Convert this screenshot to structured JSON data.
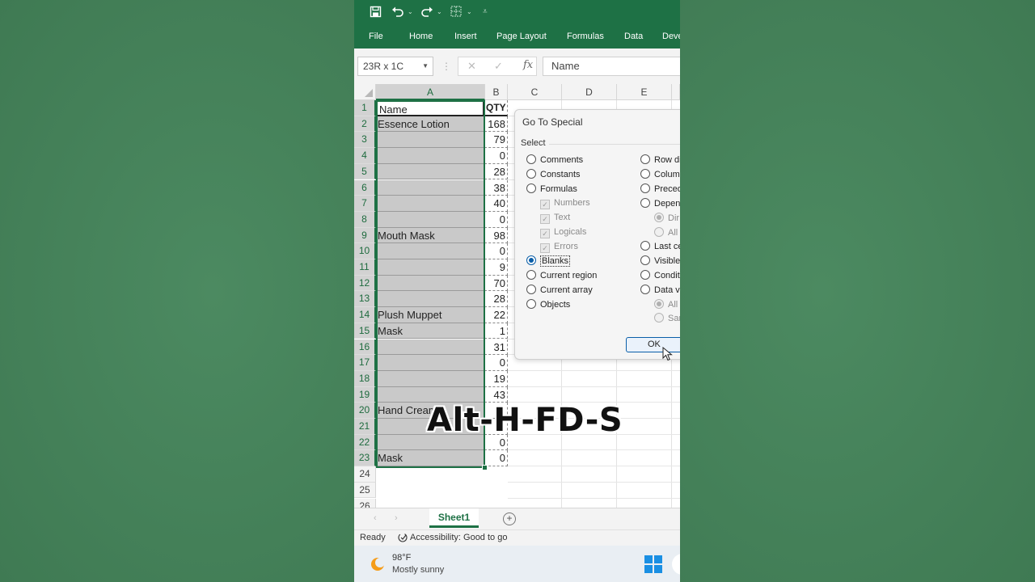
{
  "quick_access": {
    "save_icon": "save-icon",
    "undo_icon": "undo-icon",
    "redo_icon": "redo-icon",
    "borders_icon": "borders-icon",
    "more_icon": "customize-icon"
  },
  "ribbon_tabs": [
    "File",
    "Home",
    "Insert",
    "Page Layout",
    "Formulas",
    "Data",
    "Deve"
  ],
  "name_box": "23R x 1C",
  "formula_bar": {
    "cancel": "✕",
    "enter": "✓",
    "fx": "fx",
    "value": "Name"
  },
  "columns": [
    "A",
    "B",
    "C",
    "D",
    "E"
  ],
  "rows": [
    {
      "num": "1",
      "a": "Name",
      "b": "QTY"
    },
    {
      "num": "2",
      "a": "Essence Lotion",
      "b": "168"
    },
    {
      "num": "3",
      "a": "",
      "b": "79"
    },
    {
      "num": "4",
      "a": "",
      "b": "0"
    },
    {
      "num": "5",
      "a": "",
      "b": "28"
    },
    {
      "num": "6",
      "a": "",
      "b": "38"
    },
    {
      "num": "7",
      "a": "",
      "b": "40"
    },
    {
      "num": "8",
      "a": "",
      "b": "0"
    },
    {
      "num": "9",
      "a": "Mouth Mask",
      "b": "98"
    },
    {
      "num": "10",
      "a": "",
      "b": "0"
    },
    {
      "num": "11",
      "a": "",
      "b": "9"
    },
    {
      "num": "12",
      "a": "",
      "b": "70"
    },
    {
      "num": "13",
      "a": "",
      "b": "28"
    },
    {
      "num": "14",
      "a": "Plush Muppet",
      "b": "22"
    },
    {
      "num": "15",
      "a": "Mask",
      "b": "1"
    },
    {
      "num": "16",
      "a": "",
      "b": "31"
    },
    {
      "num": "17",
      "a": "",
      "b": "0"
    },
    {
      "num": "18",
      "a": "",
      "b": "19"
    },
    {
      "num": "19",
      "a": "",
      "b": "43"
    },
    {
      "num": "20",
      "a": "Hand Cream",
      "b": ""
    },
    {
      "num": "21",
      "a": "",
      "b": ""
    },
    {
      "num": "22",
      "a": "",
      "b": "0"
    },
    {
      "num": "23",
      "a": "Mask",
      "b": "0"
    },
    {
      "num": "24",
      "a": "",
      "b": ""
    },
    {
      "num": "25",
      "a": "",
      "b": ""
    },
    {
      "num": "26",
      "a": "",
      "b": ""
    }
  ],
  "dialog": {
    "title": "Go To Special",
    "select_label": "Select",
    "left_options": [
      "Comments",
      "Constants",
      "Formulas",
      "Numbers",
      "Text",
      "Logicals",
      "Errors",
      "Blanks",
      "Current region",
      "Current array",
      "Objects"
    ],
    "right_options": [
      "Row di",
      "Colum",
      "Preced",
      "Depen",
      "Dir",
      "All l",
      "Last ce",
      "Visible",
      "Condit",
      "Data v",
      "All",
      "Sam"
    ],
    "ok": "OK"
  },
  "sheet_tab": "Sheet1",
  "status": {
    "ready": "Ready",
    "accessibility": "Accessibility: Good to go"
  },
  "weather": {
    "temp": "98°F",
    "desc": "Mostly sunny"
  },
  "overlay": "Alt-H-FD-S"
}
